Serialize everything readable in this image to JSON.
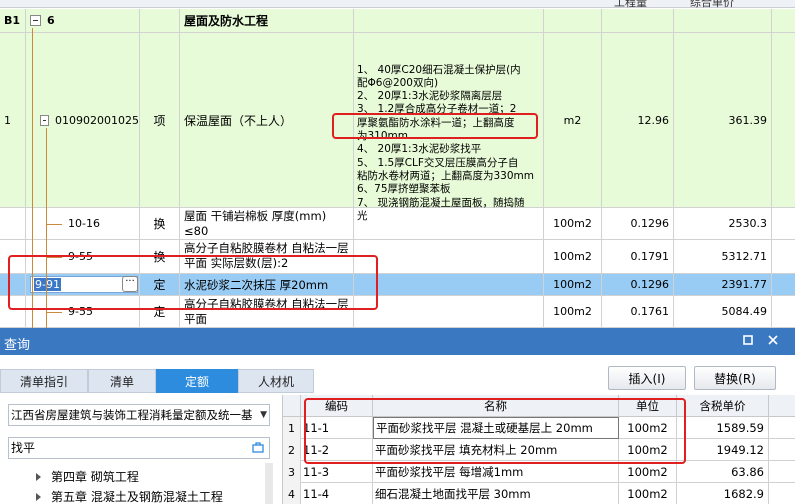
{
  "grid": {
    "header": {
      "qty": "工程量",
      "price": "综合单价"
    },
    "section": {
      "id": "B1",
      "code": "6",
      "name": "屋面及防水工程"
    },
    "item": {
      "row_no": "1",
      "code": "010902001025",
      "type": "项",
      "name": "保温屋面（不上人）",
      "desc": [
        "1、 40厚C20细石混凝土保护层(内",
        "配Φ6@200双向)",
        "2、 20厚1:3水泥砂浆隔离层层",
        "3、 1.2厚合成高分子卷材一道；2",
        "厚聚氨酯防水涂料一道；上翻高度",
        "为310mm",
        "4、 20厚1:3水泥砂浆找平",
        "5、 1.5厚CLF交叉层压膜高分子自",
        "粘防水卷材两道；上翻高度为330mm",
        "6、75厚挤塑聚苯板",
        "7、 现浇钢筋混凝土屋面板，随捣随",
        "光"
      ],
      "unit": "m2",
      "qty": "12.96",
      "price": "361.39"
    },
    "subitems": [
      {
        "code": "10-16",
        "type": "换",
        "name": "屋面 干铺岩棉板 厚度(mm) ≤80",
        "unit": "100m2",
        "qty": "0.1296",
        "price": "2530.3"
      },
      {
        "code": "9-55",
        "type": "换",
        "name": "高分子自粘胶膜卷材 自粘法一层 平面  实际层数(层):2",
        "unit": "100m2",
        "qty": "0.1791",
        "price": "5312.71"
      },
      {
        "code": "9-91",
        "type": "定",
        "name": "水泥砂浆二次抹压 厚20mm",
        "unit": "100m2",
        "qty": "0.1296",
        "price": "2391.77"
      },
      {
        "code": "9-55",
        "type": "定",
        "name": "高分子自粘胶膜卷材 自粘法一层 平面",
        "unit": "100m2",
        "qty": "0.1761",
        "price": "5084.49"
      }
    ],
    "edit_value": "9-91",
    "edit_button": "···"
  },
  "panel": {
    "title": "查询",
    "icons": {
      "restore": "restore-icon",
      "close": "close-icon"
    },
    "tabs": [
      "清单指引",
      "清单",
      "定额",
      "人材机"
    ],
    "active_tab": "定额",
    "insert_label": "插入(I)",
    "replace_label": "替换(R)",
    "library": "江西省房屋建筑与装饰工程消耗量定额及统一基",
    "search_value": "找平",
    "tree": [
      "第四章 砌筑工程",
      "第五章 混凝土及钢筋混凝土工程"
    ],
    "table": {
      "headers": [
        "编码",
        "名称",
        "单位",
        "含税单价"
      ],
      "rows": [
        {
          "no": "1",
          "code": "11-1",
          "name": "平面砂浆找平层 混凝土或硬基层上 20mm",
          "unit": "100m2",
          "price": "1589.59"
        },
        {
          "no": "2",
          "code": "11-2",
          "name": "平面砂浆找平层 填充材料上 20mm",
          "unit": "100m2",
          "price": "1949.12"
        },
        {
          "no": "3",
          "code": "11-3",
          "name": "平面砂浆找平层 每增减1mm",
          "unit": "100m2",
          "price": "63.86"
        },
        {
          "no": "4",
          "code": "11-4",
          "name": "细石混凝土地面找平层 30mm",
          "unit": "100m2",
          "price": "1682.9"
        }
      ]
    }
  }
}
